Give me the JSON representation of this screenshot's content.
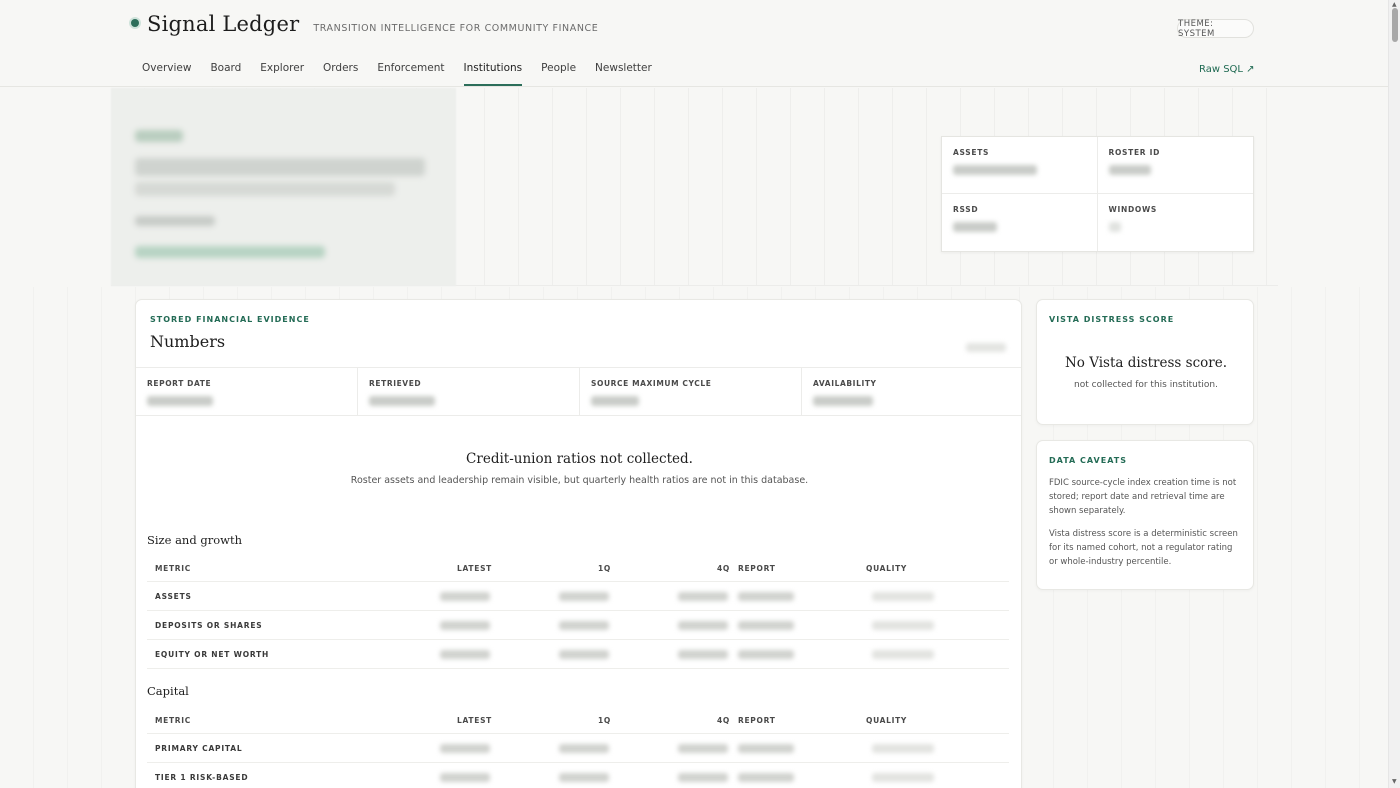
{
  "brand": {
    "name": "Signal Ledger",
    "tagline": "TRANSITION INTELLIGENCE FOR COMMUNITY FINANCE"
  },
  "theme_toggle": "THEME: SYSTEM",
  "nav": {
    "items": [
      "Overview",
      "Board",
      "Explorer",
      "Orders",
      "Enforcement",
      "Institutions",
      "People",
      "Newsletter"
    ],
    "active": "Institutions",
    "raw_sql": "Raw SQL ↗"
  },
  "identity": {
    "assets_label": "ASSETS",
    "roster_label": "ROSTER ID",
    "rssd_label": "RSSD",
    "windows_label": "WINDOWS"
  },
  "evidence": {
    "eyebrow": "STORED FINANCIAL EVIDENCE",
    "title": "Numbers",
    "stats": [
      "REPORT DATE",
      "RETRIEVED",
      "SOURCE MAXIMUM CYCLE",
      "AVAILABILITY"
    ],
    "notice_title": "Credit-union ratios not collected.",
    "notice_sub": "Roster assets and leadership remain visible, but quarterly health ratios are not in this database.",
    "columns": [
      "METRIC",
      "LATEST",
      "1Q",
      "4Q",
      "REPORT",
      "QUALITY"
    ],
    "size_growth": {
      "title": "Size and growth",
      "rows": [
        "ASSETS",
        "DEPOSITS OR SHARES",
        "EQUITY OR NET WORTH"
      ]
    },
    "capital": {
      "title": "Capital",
      "rows": [
        "PRIMARY CAPITAL",
        "TIER 1 RISK-BASED"
      ]
    }
  },
  "vista": {
    "eyebrow": "VISTA DISTRESS SCORE",
    "title": "No Vista distress score.",
    "sub": "not collected for this institution."
  },
  "caveats": {
    "eyebrow": "DATA CAVEATS",
    "items": [
      "FDIC source-cycle index creation time is not stored; report date and retrieval time are shown separately.",
      "Vista distress score is a deterministic screen for its named cohort, not a regulator rating or whole-industry percentile."
    ]
  }
}
